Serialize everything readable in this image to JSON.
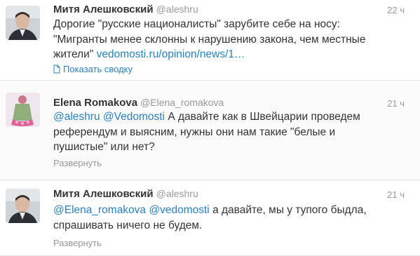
{
  "tweets": [
    {
      "name": "Митя Алешковский",
      "handle": "@aleshru",
      "time": "22 ч",
      "text_part1": "Дорогие \"русские националисты\" зарубите себе на носу:",
      "text_part2": "\"Мигранты менее склонны к нарушению закона, чем местные",
      "text_part3_plain": "жители\"",
      "text_part3_link": "vedomosti.ru/opinion/news/1…",
      "action_label": "Показать сводку",
      "action_icon": "document-icon"
    },
    {
      "name": "Elena Romakova",
      "handle": "@Elena_romakova",
      "time": "21 ч",
      "mention1": "@aleshru",
      "mention2": "@Vedomosti",
      "text_part1": " А давайте как в Швейцарии проведем",
      "text_part2": "референдум и выясним, нужны они нам такие \"белые и",
      "text_part3": "пушистые\" или нет?",
      "action_label": "Развернуть"
    },
    {
      "name": "Митя Алешковский",
      "handle": "@aleshru",
      "time": "21 ч",
      "mention1": "@Elena_romakova",
      "mention2": "@vedomosti",
      "text_part1": " а давайте, мы у тупого быдла,",
      "text_part2": "спрашивать ничего не будем.",
      "action_label": "Развернуть"
    }
  ],
  "colors": {
    "link": "#2a7fc1",
    "muted": "#999999",
    "text": "#333333"
  }
}
